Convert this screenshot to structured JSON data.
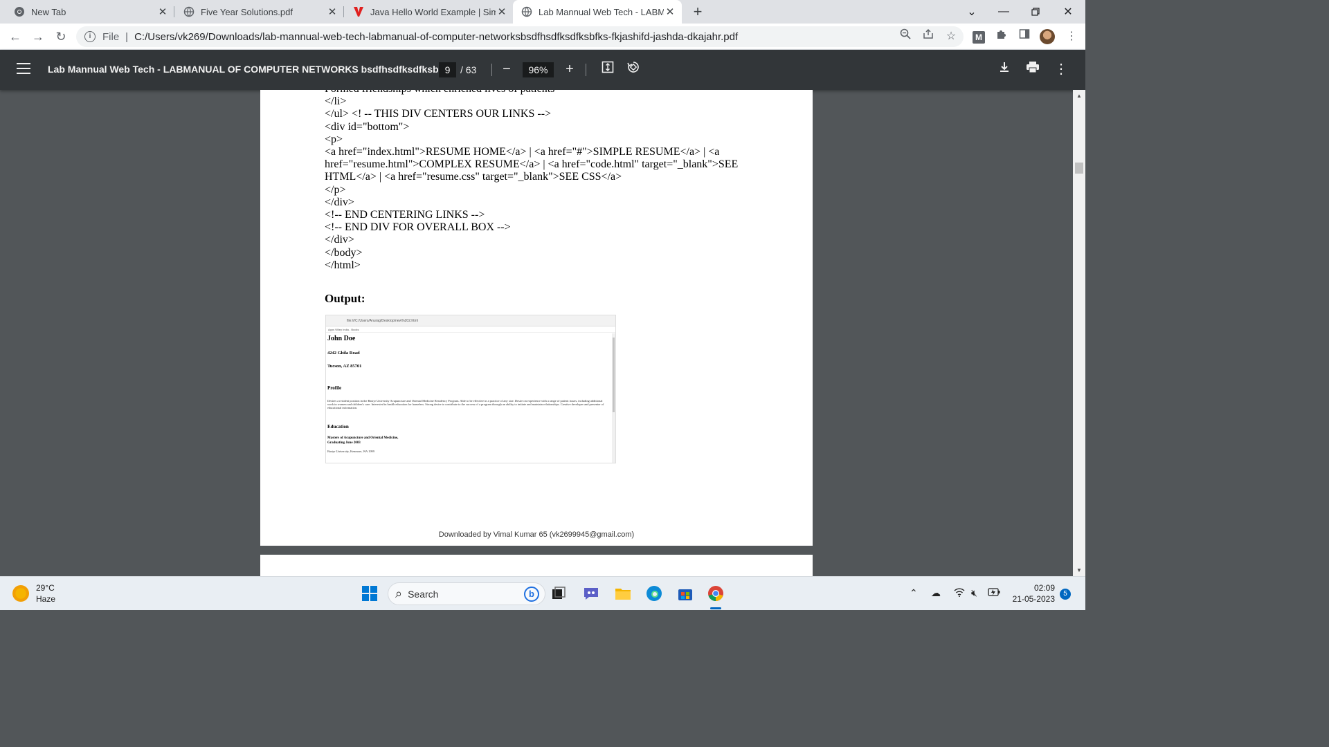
{
  "tabs": [
    {
      "title": "New Tab",
      "icon": "chrome-icon"
    },
    {
      "title": "Five Year Solutions.pdf",
      "icon": "globe-icon"
    },
    {
      "title": "Java Hello World Example | Simpl",
      "icon": "vector-logo-icon"
    },
    {
      "title": "Lab Mannual Web Tech - LABMA",
      "icon": "globe-icon",
      "active": true
    }
  ],
  "omnibox": {
    "scheme": "File",
    "url": "C:/Users/vk269/Downloads/lab-mannual-web-tech-labmanual-of-computer-networksbsdfhsdfksdfksbfks-fkjashifd-jashda-dkajahr.pdf"
  },
  "extensions": {
    "m_label": "M"
  },
  "pdf": {
    "title": "Lab Mannual Web Tech - LABMANUAL OF COMPUTER NETWORKS bsdfhsdfksdfksb...",
    "current_page": "9",
    "total_pages": "/ 63",
    "zoom": "96%"
  },
  "code_lines": [
    "Formed friendships which enriched lives of patients",
    "</li>",
    "</ul> <! -- THIS DIV CENTERS OUR LINKS -->",
    "<div id=\"bottom\">",
    "<p>",
    "<a href=\"index.html\">RESUME HOME</a> | <a href=\"#\">SIMPLE RESUME</a> | <a href=\"resume.html\">COMPLEX RESUME</a> | <a href=\"code.html\" target=\"_blank\">SEE HTML</a> | <a href=\"resume.css\" target=\"_blank\">SEE CSS</a>",
    "</p>",
    "</div>",
    "<!-- END CENTERING LINKS -->",
    "<!-- END DIV FOR OVERALL BOX -->",
    "</div>",
    "</body>",
    "</html>"
  ],
  "output_heading": "Output:",
  "screenshot": {
    "url": "file:///C:/Users/Anurag/Desktop/new%202.html",
    "bookmarks": "Apps   Wiley India - Books",
    "name": "John Doe",
    "address1": "4242 Ghila Road",
    "address2": "Tucson, AZ 85701",
    "profile_heading": "Profile",
    "profile_text": "Desires a resident position in the Bastyr University Acupuncture and Oriental Medicine Residency Program. Able to be effective in a practice of any size. Desire on experience with a range of patient issues, including additional work in women and children's care. Interested in health education for homeless. Strong desire to contribute to the success of a program through an ability to initiate and maintain relationships. Creative developer and presenter of educational information.",
    "education_heading": "Education",
    "degree": "Masters of Acupuncture and Oriental Medicine,",
    "graduation": "Graduating June 2003",
    "school": "Bastyr University, Kenmore, WA 1999"
  },
  "footer": "Downloaded by Vimal Kumar 65 (vk2699945@gmail.com)",
  "taskbar": {
    "temperature": "29°C",
    "weather": "Haze",
    "search_placeholder": "Search",
    "time": "02:09",
    "date": "21-05-2023",
    "notifications": "5"
  },
  "colors": {
    "accent": "#1a73e8",
    "pdf_toolbar": "#323639",
    "pdf_bg": "#525659"
  }
}
